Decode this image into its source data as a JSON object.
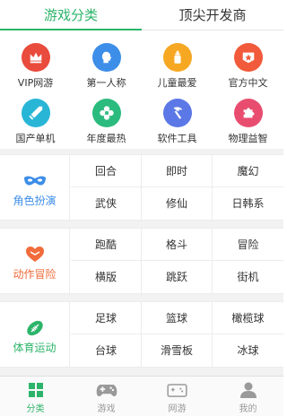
{
  "tabs": [
    {
      "label": "游戏分类",
      "active": true
    },
    {
      "label": "顶尖开发商",
      "active": false
    }
  ],
  "icon_grid": [
    {
      "label": "VIP网游",
      "icon": "crown-icon",
      "color": "#e94b3c"
    },
    {
      "label": "第一人称",
      "icon": "person-head-icon",
      "color": "#3d8ee8"
    },
    {
      "label": "儿童最爱",
      "icon": "baby-bottle-icon",
      "color": "#f7a823"
    },
    {
      "label": "官方中文",
      "icon": "star-badge-icon",
      "color": "#f15a3a"
    },
    {
      "label": "国产单机",
      "icon": "sword-icon",
      "color": "#29b6d6"
    },
    {
      "label": "年度最热",
      "icon": "flower-icon",
      "color": "#2cbb7e"
    },
    {
      "label": "软件工具",
      "icon": "hammer-icon",
      "color": "#5b78e6"
    },
    {
      "label": "物理益智",
      "icon": "puzzle-icon",
      "color": "#e84d6f"
    }
  ],
  "categories": [
    {
      "label": "角色扮演",
      "icon": "mask-icon",
      "color": "#3d8ee8",
      "options": [
        "回合",
        "即时",
        "魔幻",
        "武侠",
        "修仙",
        "日韩系"
      ]
    },
    {
      "label": "动作冒险",
      "icon": "heart-icon",
      "color": "#f26b3a",
      "options": [
        "跑酷",
        "格斗",
        "冒险",
        "横版",
        "跳跃",
        "街机"
      ]
    },
    {
      "label": "体育运动",
      "icon": "football-icon",
      "color": "#2cb46a",
      "options": [
        "足球",
        "篮球",
        "橄榄球",
        "台球",
        "滑雪板",
        "冰球"
      ]
    }
  ],
  "bottom_nav": [
    {
      "label": "分类",
      "icon": "grid-icon",
      "active": true
    },
    {
      "label": "游戏",
      "icon": "gamepad-icon",
      "active": false
    },
    {
      "label": "网游",
      "icon": "online-game-icon",
      "active": false
    },
    {
      "label": "我的",
      "icon": "user-icon",
      "active": false
    }
  ],
  "colors": {
    "accent": "#2cb46a",
    "inactive": "#999999",
    "divider": "#ececec"
  }
}
